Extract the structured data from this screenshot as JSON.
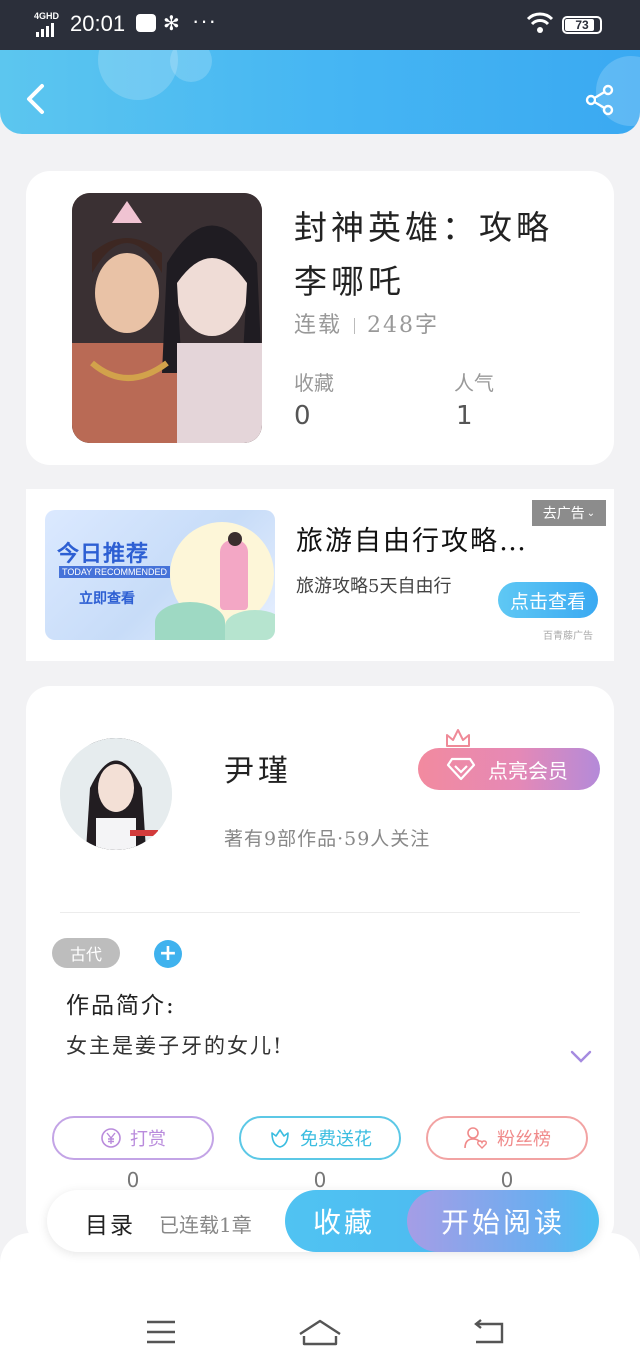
{
  "status_bar": {
    "network": "4GHD",
    "time": "20:01",
    "more": "···",
    "battery": "73"
  },
  "book": {
    "title": "封神英雄：攻略李哪吒",
    "status": "连载",
    "word_count": "248字",
    "stats": [
      {
        "label": "收藏",
        "value": "0"
      },
      {
        "label": "人气",
        "value": "1"
      }
    ]
  },
  "ad": {
    "banner_title": "今日推荐",
    "banner_subtitle": "TODAY RECOMMENDED",
    "banner_button": "立即查看",
    "title": "旅游自由行攻略…",
    "description": "旅游攻略5天自由行",
    "tag": "去广告",
    "button": "点击查看",
    "source": "百青藤广告"
  },
  "author": {
    "name": "尹瑾",
    "meta": "著有9部作品·59人关注",
    "vip_button": "点亮会员"
  },
  "tags": [
    "古代"
  ],
  "intro": {
    "label": "作品简介:",
    "text": "女主是姜子牙的女儿!"
  },
  "actions": [
    {
      "label": "打赏",
      "count": "0",
      "color": "#b98bdc"
    },
    {
      "label": "免费送花",
      "count": "0",
      "color": "#3bbde0"
    },
    {
      "label": "粉丝榜",
      "count": "0",
      "color": "#f08a8a"
    }
  ],
  "bottom_bar": {
    "catalog": "目录",
    "chapters": "已连载1章",
    "collect": "收藏",
    "read": "开始阅读"
  },
  "colors": {
    "header_gradient": [
      "#5cc6ef",
      "#3aa9f2"
    ],
    "accent": "#3fb2ee"
  }
}
